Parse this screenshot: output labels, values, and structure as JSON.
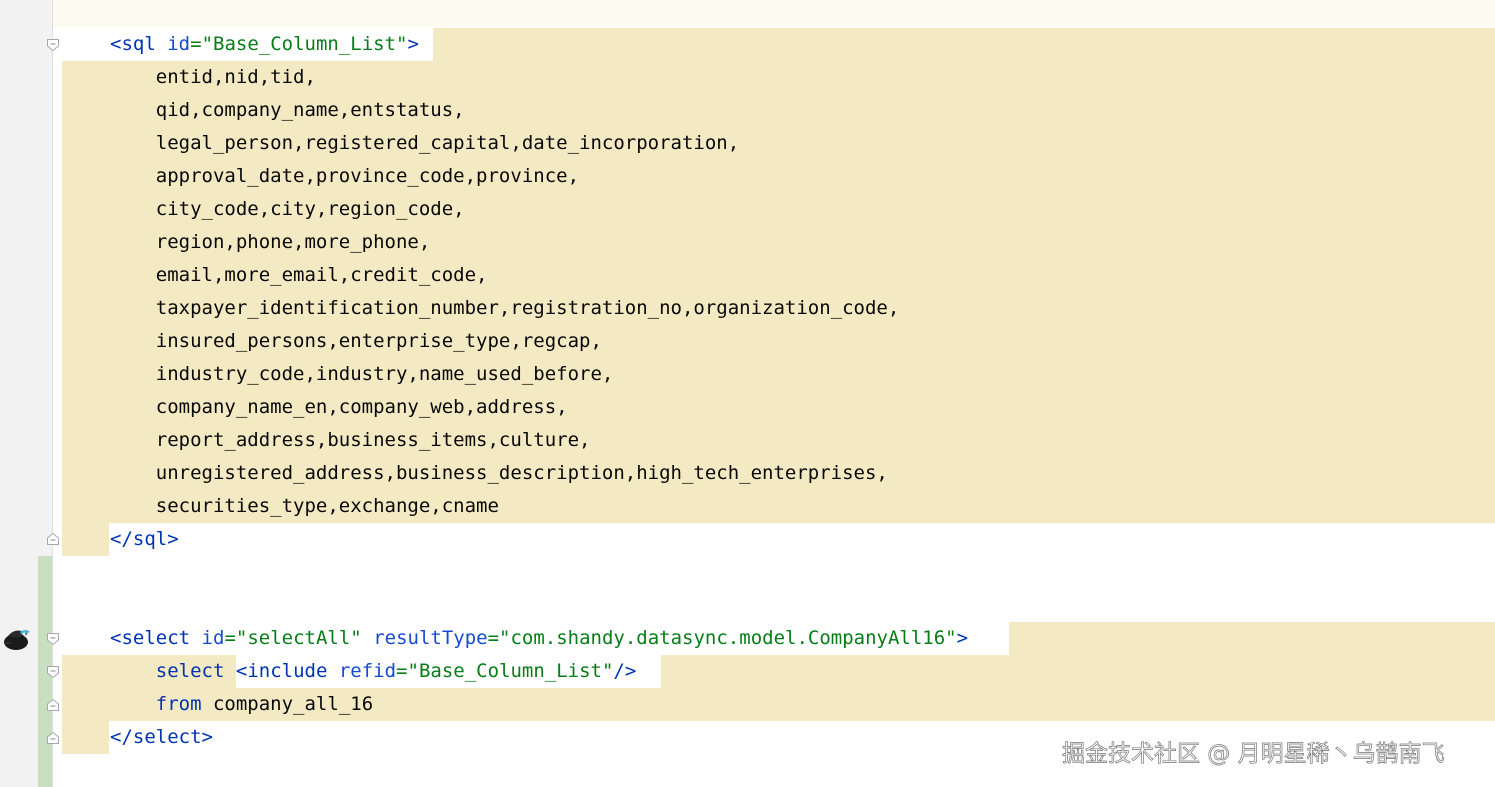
{
  "editor": {
    "sql_block": {
      "open_tag": "sql",
      "id_attr": "id",
      "id_value": "\"Base_Column_List\"",
      "columns": [
        "entid,nid,tid,",
        "qid,company_name,entstatus,",
        "legal_person,registered_capital,date_incorporation,",
        "approval_date,province_code,province,",
        "city_code,city,region_code,",
        "region,phone,more_phone,",
        "email,more_email,credit_code,",
        "taxpayer_identification_number,registration_no,organization_code,",
        "insured_persons,enterprise_type,regcap,",
        "industry_code,industry,name_used_before,",
        "company_name_en,company_web,address,",
        "report_address,business_items,culture,",
        "unregistered_address,business_description,high_tech_enterprises,",
        "securities_type,exchange,cname"
      ],
      "close_tag": "sql"
    },
    "select_block": {
      "open_tag": "select",
      "id_attr": "id",
      "id_value": "\"selectAll\"",
      "result_attr": "resultType",
      "result_value": "\"com.shandy.datasync.model.CompanyAll16\"",
      "line2_keyword": "select",
      "include_tag": "include",
      "refid_attr": "refid",
      "refid_value": "\"Base_Column_List\"",
      "line3_keyword": "from",
      "line3_table": "company_all_16",
      "close_tag": "select"
    }
  },
  "gutter": {
    "icons": [
      "fold-marker-icon",
      "bird-avatar-icon"
    ]
  },
  "watermark": "掘金技术社区 @ 月明星稀丶乌鹊南飞",
  "colors": {
    "highlight": "#f3e9c3",
    "tag": "#0033b3",
    "attribute": "#174ad4",
    "string": "#067d17",
    "text": "#080808",
    "gutter": "#f2f2f2",
    "change_bar": "#c9dfc2"
  }
}
